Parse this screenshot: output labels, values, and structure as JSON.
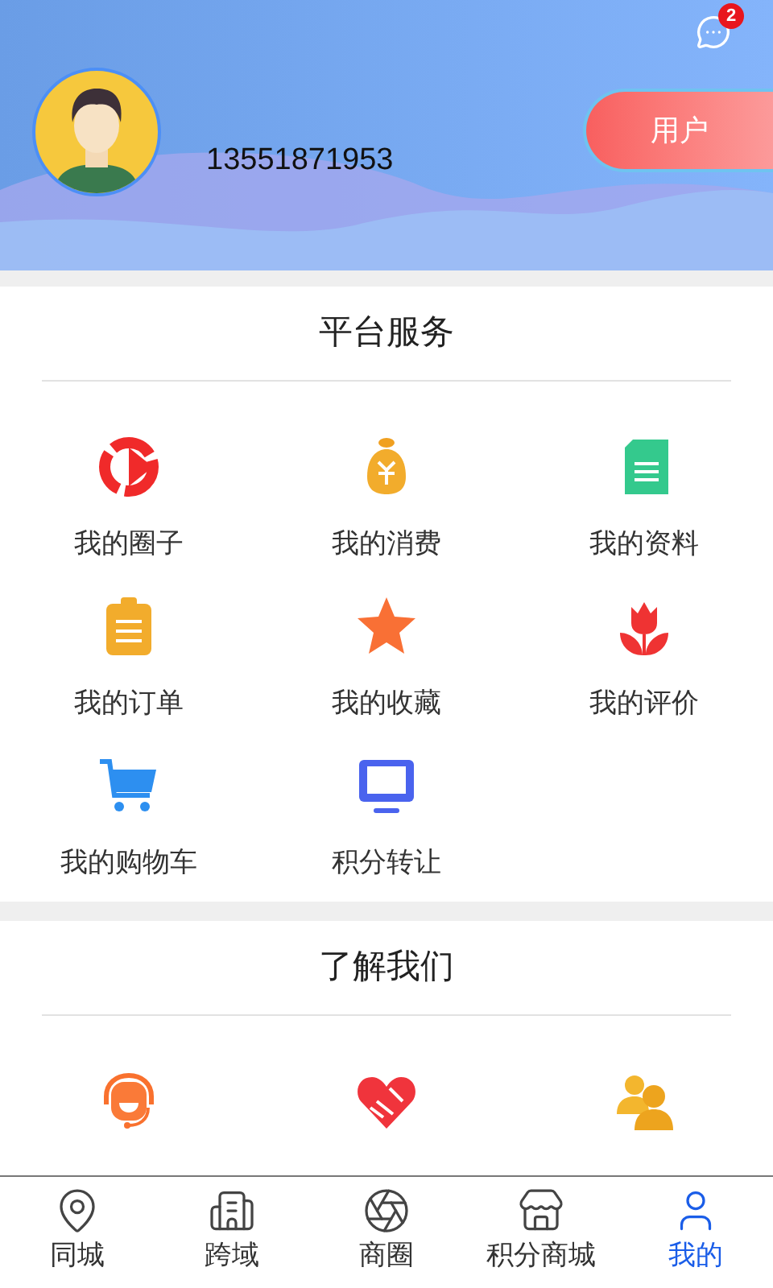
{
  "header": {
    "message_badge": "2",
    "phone": "13551871953",
    "role_button": "用户"
  },
  "sections": [
    {
      "title": "平台服务",
      "items": [
        {
          "label": "我的圈子",
          "kind": "play"
        },
        {
          "label": "我的消费",
          "kind": "moneybag"
        },
        {
          "label": "我的资料",
          "kind": "document"
        },
        {
          "label": "我的订单",
          "kind": "clipboard"
        },
        {
          "label": "我的收藏",
          "kind": "star"
        },
        {
          "label": "我的评价",
          "kind": "tulip"
        },
        {
          "label": "我的购物车",
          "kind": "cart"
        },
        {
          "label": "积分转让",
          "kind": "monitor"
        }
      ]
    },
    {
      "title": "了解我们",
      "items": [
        {
          "kind": "headset"
        },
        {
          "kind": "handshake"
        },
        {
          "kind": "people"
        }
      ]
    }
  ],
  "tabs": [
    {
      "label": "同城",
      "kind": "pin",
      "selected": false
    },
    {
      "label": "跨域",
      "kind": "city",
      "selected": false
    },
    {
      "label": "商圈",
      "kind": "aperture",
      "selected": false
    },
    {
      "label": "积分商城",
      "kind": "store",
      "selected": false
    },
    {
      "label": "我的",
      "kind": "user",
      "selected": true
    }
  ]
}
